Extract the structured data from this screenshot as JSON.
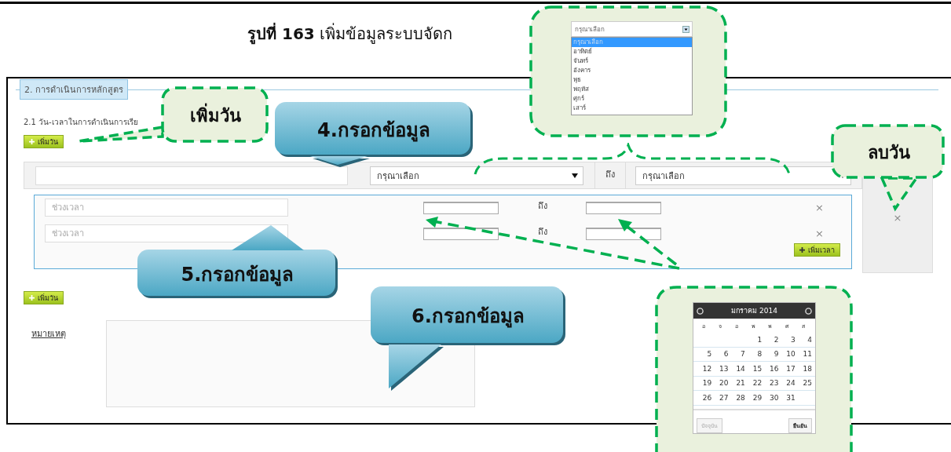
{
  "caption": {
    "label": "รูปที่ 163",
    "text": "เพิ่มข้อมูลระบบจัดก"
  },
  "section": {
    "legend": "2. การดำเนินการหลักสูตร",
    "subheading": "2.1 วัน-เวลาในการดำเนินการเรีย"
  },
  "add_day_buttons": [
    "เพิ่มวัน",
    "เพิ่มวัน"
  ],
  "day_row": {
    "day_from": "กรุณาเลือก",
    "to_label": "ถึง",
    "day_to": "กรุณาเลือก",
    "remove": "×"
  },
  "time_rows": [
    {
      "placeholder": "ช่วงเวลา",
      "to_label": "ถึง",
      "remove": "×"
    },
    {
      "placeholder": "ช่วงเวลา",
      "to_label": "ถึง",
      "remove": "×"
    }
  ],
  "add_time_button": "เพิ่มเวลา",
  "note": {
    "label": "หมายเหตุ"
  },
  "callouts": [
    {
      "kind": "note",
      "text": "เพิ่มวัน"
    },
    {
      "kind": "step",
      "text": "4.กรอกข้อมูล"
    },
    {
      "kind": "step",
      "text": "5.กรอกข้อมูล"
    },
    {
      "kind": "step",
      "text": "6.กรอกข้อมูล"
    },
    {
      "kind": "note",
      "text": "ลบวัน"
    }
  ],
  "dropdown_popup": {
    "value": "กรุณาเลือก",
    "options": [
      {
        "label": "กรุณาเลือก",
        "selected": true
      },
      {
        "label": "อาทิตย์",
        "selected": false
      },
      {
        "label": "จันทร์",
        "selected": false
      },
      {
        "label": "อังคาร",
        "selected": false
      },
      {
        "label": "พุธ",
        "selected": false
      },
      {
        "label": "พฤหัส",
        "selected": false
      },
      {
        "label": "ศุกร์",
        "selected": false
      },
      {
        "label": "เสาร์",
        "selected": false
      }
    ]
  },
  "calendar": {
    "title": "มกราคม 2014",
    "weekdays": [
      "อ",
      "จ",
      "อ",
      "พ",
      "พ",
      "ศ",
      "ส"
    ],
    "weeks": [
      [
        "1",
        "2",
        "3",
        "4"
      ],
      [
        "5",
        "6",
        "7",
        "8",
        "9",
        "10",
        "11"
      ],
      [
        "12",
        "13",
        "14",
        "15",
        "16",
        "17",
        "18"
      ],
      [
        "19",
        "20",
        "21",
        "22",
        "23",
        "24",
        "25"
      ],
      [
        "26",
        "27",
        "28",
        "29",
        "30",
        "31"
      ]
    ],
    "today_button": {
      "label": "ปัจจุบัน",
      "disabled": true
    },
    "confirm_button": "ยืนยัน"
  }
}
